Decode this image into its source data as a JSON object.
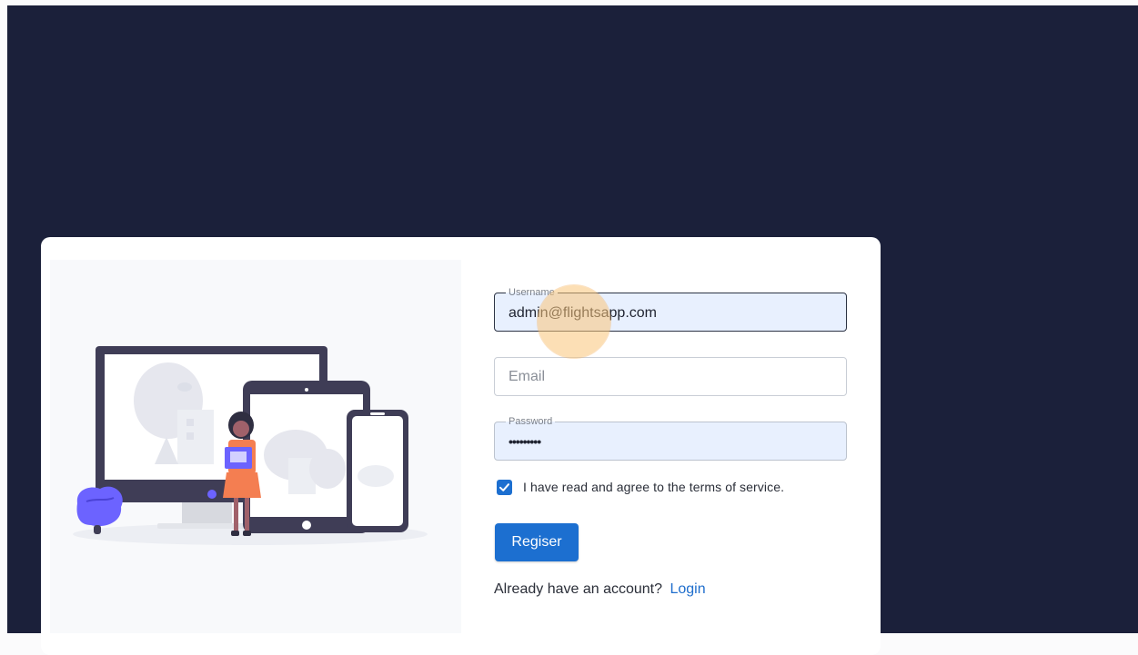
{
  "form": {
    "username": {
      "label": "Username",
      "value": "admin@flightsapp.com"
    },
    "email": {
      "placeholder": "Email"
    },
    "password": {
      "label": "Password",
      "value": "•••••••••"
    },
    "terms": {
      "checked": true,
      "label": "I have read and agree to the terms of service."
    },
    "register_label": "Regiser",
    "login_prompt": "Already have an account?",
    "login_link": "Login"
  },
  "colors": {
    "background": "#1b203a",
    "primary": "#1c6fd0",
    "autofill": "#e8f0fe"
  },
  "icons": {
    "checkbox": "check-icon"
  }
}
